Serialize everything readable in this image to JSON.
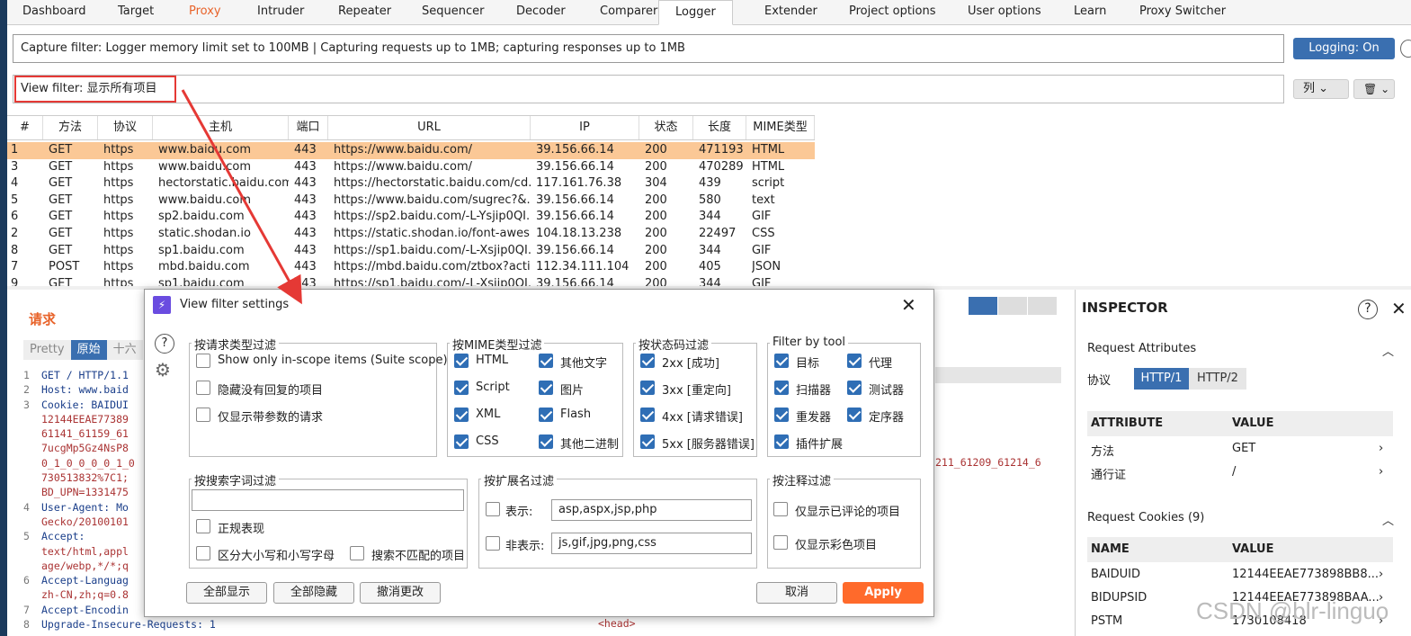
{
  "tabs": [
    "Dashboard",
    "Target",
    "Proxy",
    "Intruder",
    "Repeater",
    "Sequencer",
    "Decoder",
    "Comparer",
    "Logger",
    "Extender",
    "Project options",
    "User options",
    "Learn",
    "Proxy Switcher"
  ],
  "active_tab": "Logger",
  "capture_filter": "Capture filter: Logger memory limit set to 100MB | Capturing requests up to 1MB;  capturing responses up to 1MB",
  "logging_button": "Logging: On",
  "view_filter": "View filter: 显示所有项目",
  "columns_button": "列",
  "table": {
    "headers": [
      "#",
      "方法",
      "协议",
      "主机",
      "端口",
      "URL",
      "IP",
      "状态",
      "长度",
      "MIME类型"
    ],
    "rows": [
      [
        "1",
        "GET",
        "https",
        "www.baidu.com",
        "443",
        "https://www.baidu.com/",
        "39.156.66.14",
        "200",
        "471193",
        "HTML"
      ],
      [
        "3",
        "GET",
        "https",
        "www.baidu.com",
        "443",
        "https://www.baidu.com/",
        "39.156.66.14",
        "200",
        "470289",
        "HTML"
      ],
      [
        "4",
        "GET",
        "https",
        "hectorstatic.baidu.com",
        "443",
        "https://hectorstatic.baidu.com/cd...",
        "117.161.76.38",
        "304",
        "439",
        "script"
      ],
      [
        "5",
        "GET",
        "https",
        "www.baidu.com",
        "443",
        "https://www.baidu.com/sugrec?&...",
        "39.156.66.14",
        "200",
        "580",
        "text"
      ],
      [
        "6",
        "GET",
        "https",
        "sp2.baidu.com",
        "443",
        "https://sp2.baidu.com/-L-Ysjip0QI...",
        "39.156.66.14",
        "200",
        "344",
        "GIF"
      ],
      [
        "2",
        "GET",
        "https",
        "static.shodan.io",
        "443",
        "https://static.shodan.io/font-awes...",
        "104.18.13.238",
        "200",
        "22497",
        "CSS"
      ],
      [
        "8",
        "GET",
        "https",
        "sp1.baidu.com",
        "443",
        "https://sp1.baidu.com/-L-Xsjip0QI...",
        "39.156.66.14",
        "200",
        "344",
        "GIF"
      ],
      [
        "7",
        "POST",
        "https",
        "mbd.baidu.com",
        "443",
        "https://mbd.baidu.com/ztbox?acti...",
        "112.34.111.104",
        "200",
        "405",
        "JSON"
      ],
      [
        "9",
        "GET",
        "https",
        "sp1.baidu.com",
        "443",
        "https://sp1.baidu.com/-L-Xsjip0QI...",
        "39.156.66.14",
        "200",
        "344",
        "GIF"
      ]
    ]
  },
  "request_panel": {
    "title": "请求",
    "tabs": [
      "Pretty",
      "原始",
      "十六"
    ],
    "lines": [
      {
        "n": "1",
        "t": "GET / HTTP/1.1"
      },
      {
        "n": "2",
        "t": "Host: www.baid"
      },
      {
        "n": "3",
        "t": "Cookie: BAIDUI"
      },
      {
        "n": "",
        "t": "12144EEAE77389"
      },
      {
        "n": "",
        "t": "61141_61159_61"
      },
      {
        "n": "",
        "t": "7ucgMp5Gz4NsP8"
      },
      {
        "n": "",
        "t": "0_1_0_0_0_0_1_0"
      },
      {
        "n": "",
        "t": "730513832%7C1;"
      },
      {
        "n": "",
        "t": "BD_UPN=1331475"
      },
      {
        "n": "4",
        "t": "User-Agent: Mo"
      },
      {
        "n": "",
        "t": "Gecko/20100101"
      },
      {
        "n": "5",
        "t": "Accept:"
      },
      {
        "n": "",
        "t": "text/html,appl"
      },
      {
        "n": "",
        "t": "age/webp,*/*;q"
      },
      {
        "n": "6",
        "t": "Accept-Languag"
      },
      {
        "n": "",
        "t": "zh-CN,zh;q=0.8"
      },
      {
        "n": "7",
        "t": "Accept-Encodin"
      },
      {
        "n": "8",
        "t": "Upgrade-Insecure-Requests: 1"
      }
    ]
  },
  "response_panel": {
    "cookie_fragment": "211_61209_61214_6",
    "head_tag": "<head>"
  },
  "inspector": {
    "title": "INSPECTOR",
    "request_attributes": "Request Attributes",
    "protocol_label": "协议",
    "protocols": [
      "HTTP/1",
      "HTTP/2"
    ],
    "attr_headers": [
      "ATTRIBUTE",
      "VALUE"
    ],
    "attributes": [
      [
        "方法",
        "GET"
      ],
      [
        "通行证",
        "/"
      ]
    ],
    "cookies_title": "Request Cookies (9)",
    "cookie_headers": [
      "NAME",
      "VALUE"
    ],
    "cookies": [
      [
        "BAIDUID",
        "12144EEAE773898BB8..."
      ],
      [
        "BIDUPSID",
        "12144EEAE773898BAA..."
      ],
      [
        "PSTM",
        "1730108418"
      ]
    ]
  },
  "dialog": {
    "title": "View filter settings",
    "req_type": {
      "title": "按请求类型过滤",
      "items": [
        {
          "label": "Show only in-scope items (Suite scope)",
          "checked": false
        },
        {
          "label": "隐藏没有回复的项目",
          "checked": false
        },
        {
          "label": "仅显示带参数的请求",
          "checked": false
        }
      ]
    },
    "mime": {
      "title": "按MIME类型过滤",
      "items": [
        {
          "label": "HTML",
          "checked": true
        },
        {
          "label": "其他文字",
          "checked": true
        },
        {
          "label": "Script",
          "checked": true
        },
        {
          "label": "图片",
          "checked": true
        },
        {
          "label": "XML",
          "checked": true
        },
        {
          "label": "Flash",
          "checked": true
        },
        {
          "label": "CSS",
          "checked": true
        },
        {
          "label": "其他二进制",
          "checked": true
        }
      ]
    },
    "status": {
      "title": "按状态码过滤",
      "items": [
        {
          "label": "2xx  [成功]",
          "checked": true
        },
        {
          "label": "3xx  [重定向]",
          "checked": true
        },
        {
          "label": "4xx  [请求错误]",
          "checked": true
        },
        {
          "label": "5xx  [服务器错误]",
          "checked": true
        }
      ]
    },
    "tool": {
      "title": "Filter by tool",
      "items": [
        {
          "label": "目标",
          "checked": true
        },
        {
          "label": "代理",
          "checked": true
        },
        {
          "label": "扫描器",
          "checked": true
        },
        {
          "label": "测试器",
          "checked": true
        },
        {
          "label": "重发器",
          "checked": true
        },
        {
          "label": "定序器",
          "checked": true
        },
        {
          "label": "插件扩展",
          "checked": true
        }
      ]
    },
    "search": {
      "title": "按搜索字词过滤",
      "value": "",
      "regex": "正规表现",
      "case": "区分大小写和小写字母",
      "negate": "搜索不匹配的项目"
    },
    "ext": {
      "title": "按扩展名过滤",
      "show_label": "表示:",
      "show_value": "asp,aspx,jsp,php",
      "hide_label": "非表示:",
      "hide_value": "js,gif,jpg,png,css"
    },
    "annot": {
      "title": "按注释过滤",
      "commented": "仅显示已评论的项目",
      "highlighted": "仅显示彩色项目"
    },
    "buttons": {
      "show_all": "全部显示",
      "hide_all": "全部隐藏",
      "revert": "撤消更改",
      "cancel": "取消",
      "apply": "Apply"
    }
  },
  "watermark": "CSDN @blr-linguo"
}
